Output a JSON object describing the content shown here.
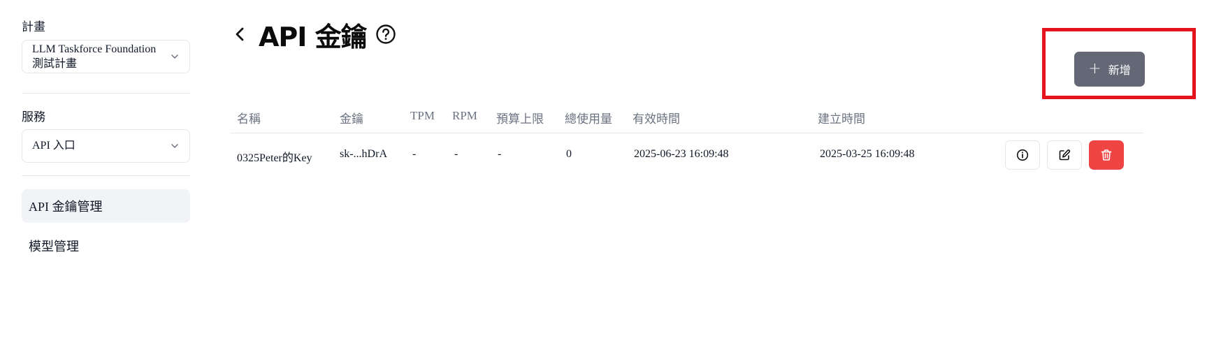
{
  "sidebar": {
    "plan_label": "計畫",
    "plan_select": {
      "line1": "LLM Taskforce Foundation",
      "line2": "測試計畫"
    },
    "service_label": "服務",
    "service_select": {
      "value": "API 入口"
    },
    "nav": [
      {
        "label": "API 金鑰管理",
        "active": true
      },
      {
        "label": "模型管理",
        "active": false
      }
    ]
  },
  "header": {
    "title": "API 金鑰",
    "add_button": {
      "label": "新增",
      "icon": "plus-icon"
    }
  },
  "table": {
    "columns": [
      "名稱",
      "金鑰",
      "TPM",
      "RPM",
      "預算上限",
      "總使用量",
      "有效時間",
      "建立時間"
    ],
    "rows": [
      {
        "name": "0325Peter的Key",
        "key": "sk-...hDrA",
        "tpm": "-",
        "rpm": "-",
        "budget": "-",
        "usage": "0",
        "valid_until": "2025-06-23 16:09:48",
        "created_at": "2025-03-25 16:09:48",
        "actions": [
          "info-icon",
          "edit-icon",
          "trash-icon"
        ]
      }
    ]
  },
  "colors": {
    "add_button_bg": "#646776",
    "delete_button_bg": "#ef4444",
    "highlight_border": "#e3141b",
    "nav_active_bg": "#f1f3f6"
  }
}
